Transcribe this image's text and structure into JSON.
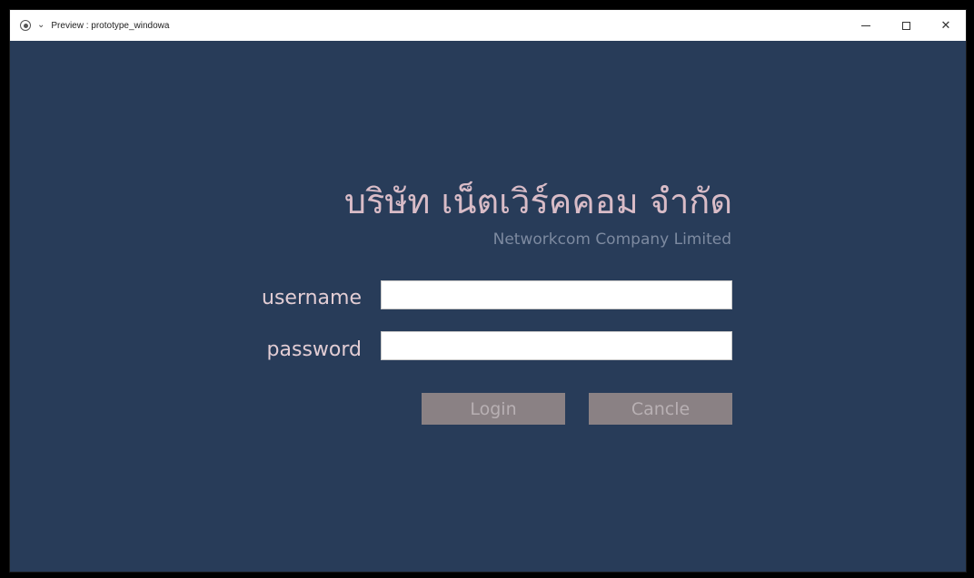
{
  "window": {
    "title": "Preview : prototype_windowa",
    "chevron_glyph": "⌄",
    "close_glyph": "✕"
  },
  "company": {
    "name_th": "บริษัท เน็ตเวิร์คคอม จำกัด",
    "name_en": "Networkcom Company Limited"
  },
  "form": {
    "username_label": "username",
    "password_label": "password",
    "username_value": "",
    "password_value": "",
    "login_label": "Login",
    "cancel_label": "Cancle"
  },
  "colors": {
    "background": "#283c59",
    "title_th": "#d9bcc7",
    "title_en": "#7d8aa0",
    "button_bg": "#8a8184",
    "button_text": "#b8b0b3"
  },
  "icons": {
    "app": "record-icon",
    "menu": "chevron-down-icon",
    "minimize": "minimize-icon",
    "maximize": "maximize-icon",
    "close": "close-icon"
  }
}
